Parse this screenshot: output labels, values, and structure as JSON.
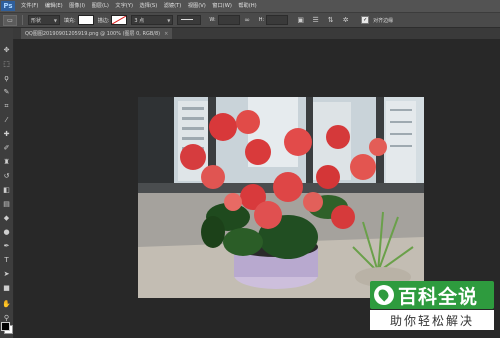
{
  "app": {
    "logo_text": "Ps"
  },
  "menu": [
    "文件(F)",
    "编辑(E)",
    "图像(I)",
    "图层(L)",
    "文字(Y)",
    "选择(S)",
    "滤镜(T)",
    "视图(V)",
    "窗口(W)",
    "帮助(H)"
  ],
  "options": {
    "shape_mode": "形状",
    "fill_label": "填充:",
    "stroke_label": "描边:",
    "stroke_size": "3 点",
    "w_label": "W:",
    "h_label": "H:",
    "align_edges_label": "对齐边缘",
    "align_edges_checked": true
  },
  "document": {
    "tab_title": "QQ图图20190901205919.png @ 100% (图层 0, RGB/8)",
    "close": "×"
  },
  "tools": [
    "move-tool",
    "marquee-tool",
    "lasso-tool",
    "quick-select-tool",
    "crop-tool",
    "eyedropper-tool",
    "healing-brush-tool",
    "brush-tool",
    "clone-stamp-tool",
    "history-brush-tool",
    "eraser-tool",
    "gradient-tool",
    "blur-tool",
    "dodge-tool",
    "pen-tool",
    "type-tool",
    "path-select-tool",
    "rectangle-tool",
    "hand-tool",
    "zoom-tool"
  ],
  "watermark": {
    "title": "百科全说",
    "subtitle": "助你轻松解决",
    "color": "#2e9b3e"
  }
}
